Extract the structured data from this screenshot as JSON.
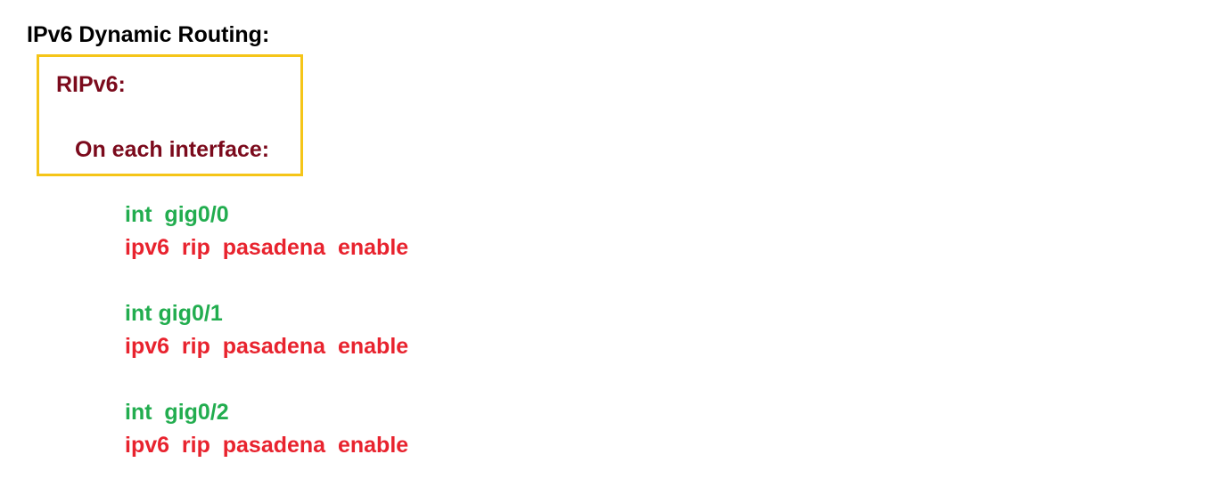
{
  "title": "IPv6 Dynamic Routing:",
  "highlight_box": {
    "heading": "RIPv6:",
    "subheading": "On each interface:"
  },
  "blocks": [
    {
      "interface_cmd": "int  gig0/0",
      "rip_cmd": "ipv6  rip  pasadena  enable"
    },
    {
      "interface_cmd": "int gig0/1",
      "rip_cmd": "ipv6  rip  pasadena  enable"
    },
    {
      "interface_cmd": "int  gig0/2",
      "rip_cmd": "ipv6  rip  pasadena  enable"
    }
  ],
  "colors": {
    "title": "#000000",
    "box_border": "#f5c518",
    "box_text": "#7b0a1c",
    "interface_cmd": "#22ad4f",
    "rip_cmd": "#e8232e"
  }
}
